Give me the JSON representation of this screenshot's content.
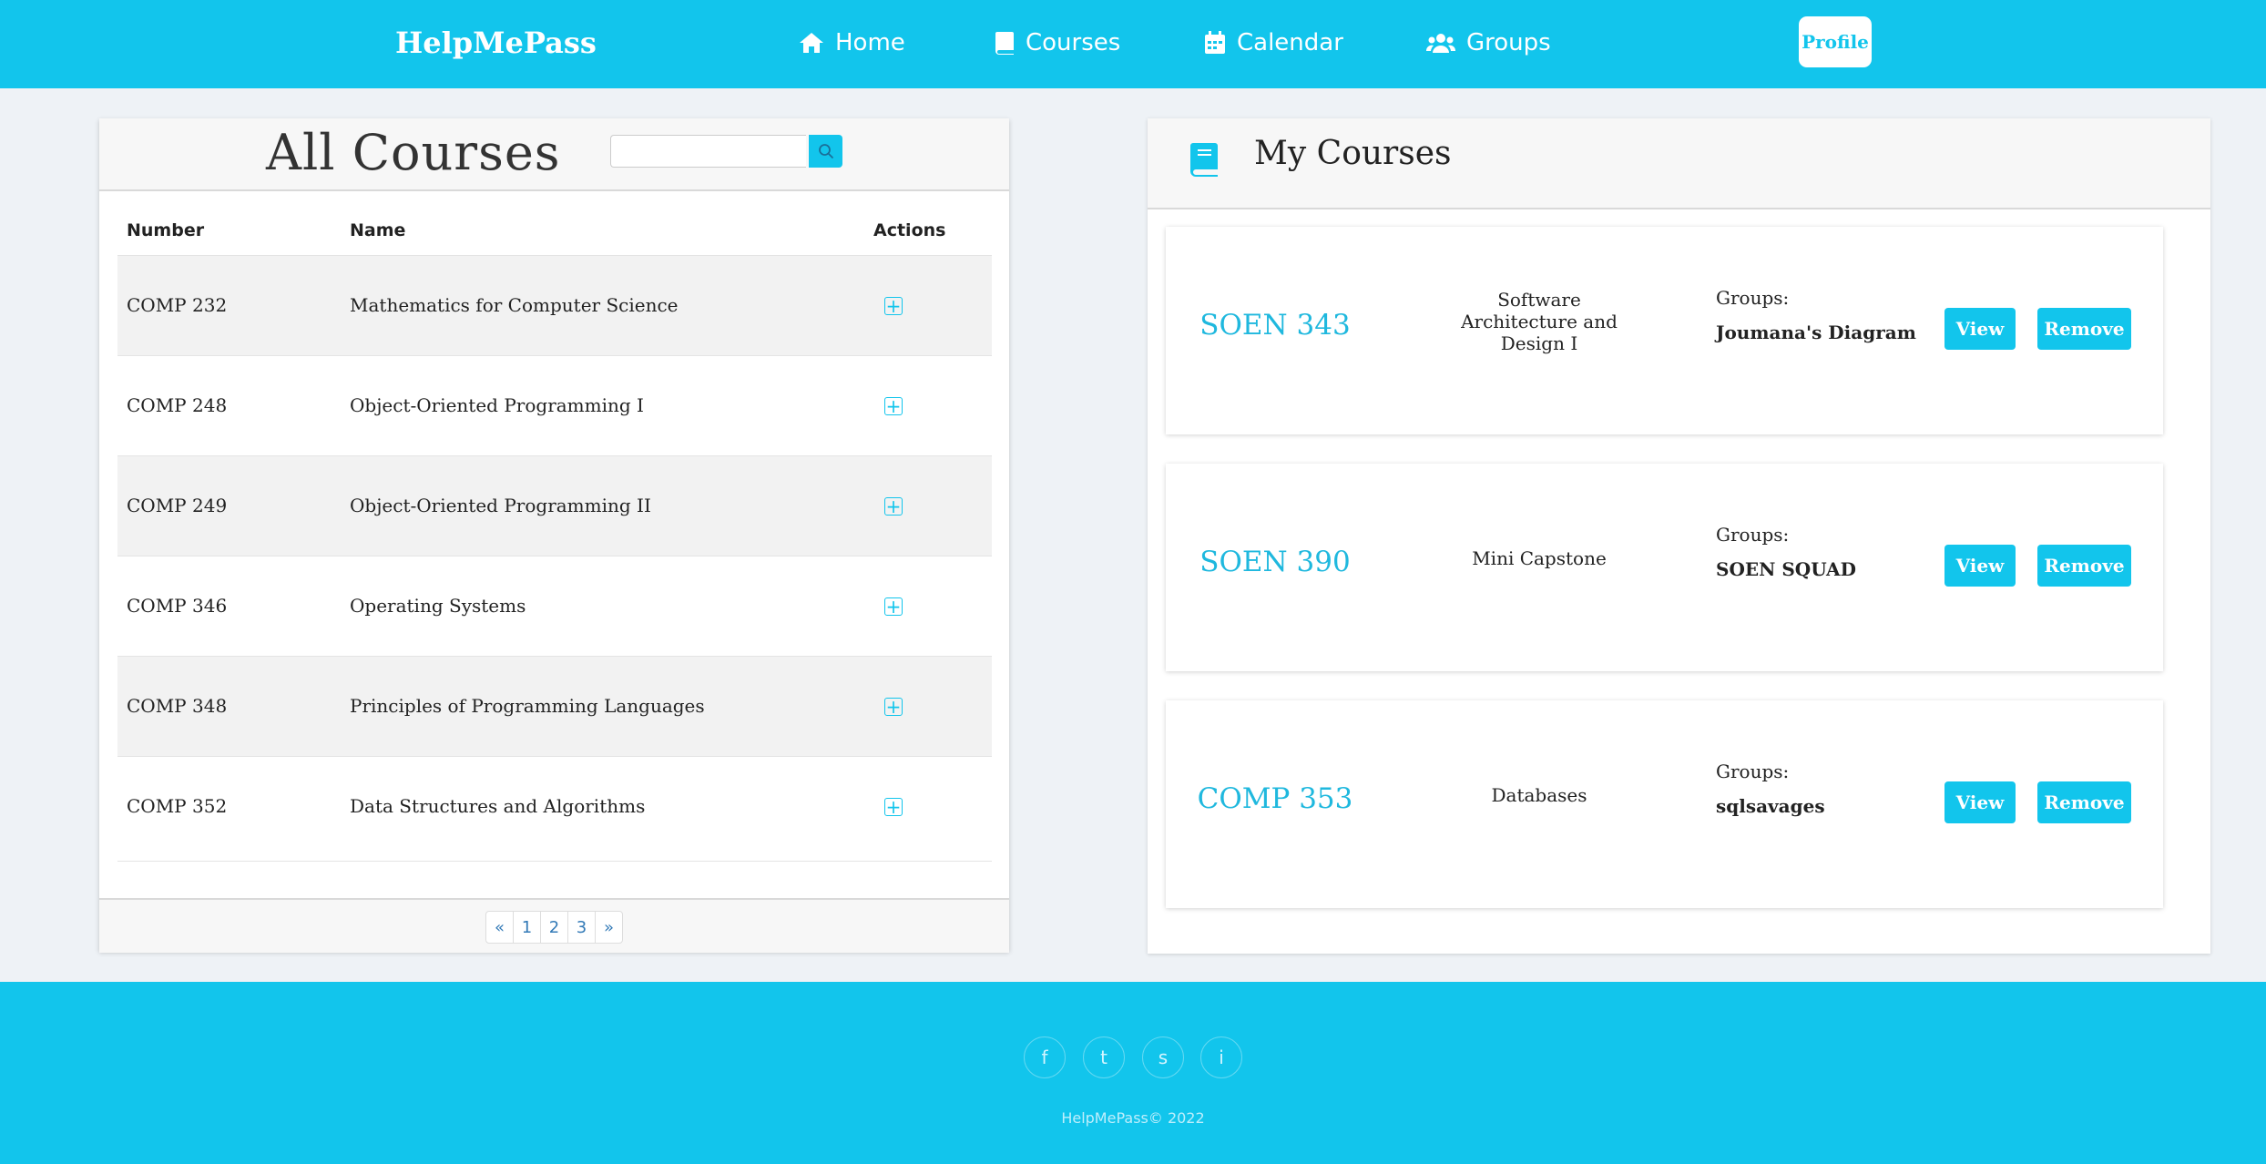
{
  "brand": "HelpMePass",
  "nav": {
    "home": "Home",
    "courses": "Courses",
    "calendar": "Calendar",
    "groups": "Groups",
    "profile": "Profile"
  },
  "all_courses": {
    "title": "All Courses",
    "search_value": "",
    "columns": {
      "number": "Number",
      "name": "Name",
      "actions": "Actions"
    },
    "rows": [
      {
        "number": "COMP 232",
        "name": "Mathematics for Computer Science"
      },
      {
        "number": "COMP 248",
        "name": "Object-Oriented Programming I"
      },
      {
        "number": "COMP 249",
        "name": "Object-Oriented Programming II"
      },
      {
        "number": "COMP 346",
        "name": "Operating Systems"
      },
      {
        "number": "COMP 348",
        "name": "Principles of Programming Languages"
      },
      {
        "number": "COMP 352",
        "name": "Data Structures and Algorithms"
      }
    ],
    "pagination": [
      "«",
      "1",
      "2",
      "3",
      "»"
    ]
  },
  "my_courses": {
    "title": "My Courses",
    "groups_label": "Groups:",
    "view_label": "View",
    "remove_label": "Remove",
    "items": [
      {
        "code": "SOEN 343",
        "name_lines": [
          "Software",
          "Architecture and",
          "Design I"
        ],
        "group": "Joumana's Diagram"
      },
      {
        "code": "SOEN 390",
        "name_lines": [
          "Mini Capstone"
        ],
        "group": "SOEN SQUAD"
      },
      {
        "code": "COMP 353",
        "name_lines": [
          "Databases"
        ],
        "group": "sqlsavages"
      }
    ]
  },
  "footer": {
    "social": [
      {
        "icon": "facebook-icon",
        "glyph": "f"
      },
      {
        "icon": "twitter-icon",
        "glyph": "t"
      },
      {
        "icon": "snapchat-icon",
        "glyph": "s"
      },
      {
        "icon": "instagram-icon",
        "glyph": "i"
      }
    ],
    "copyright": "HelpMePass© 2022"
  },
  "colors": {
    "accent": "#12c5ec",
    "link": "#1fb8de"
  }
}
